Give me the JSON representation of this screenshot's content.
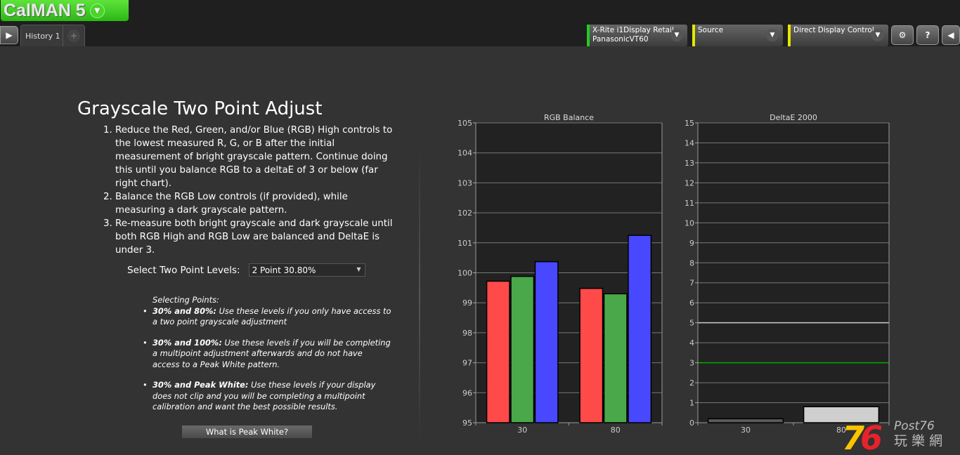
{
  "app": {
    "logo": "CalMAN 5"
  },
  "tabs": [
    {
      "label": "History 1"
    }
  ],
  "devices": [
    {
      "line1": "X-Rite i1Display Retail",
      "line2": "PanasonicVT60",
      "status_color": "#22cc22"
    },
    {
      "line1": "Source",
      "line2": "",
      "status_color": "#e6e600"
    },
    {
      "line1": "Direct Display Control",
      "line2": "",
      "status_color": "#e6e600"
    }
  ],
  "toolbar": {
    "settings": "gear-icon",
    "help": "?",
    "collapse": "chevron-left-icon"
  },
  "main": {
    "title": "Grayscale Two Point Adjust",
    "steps": [
      "Reduce the Red, Green, and/or Blue (RGB) High controls to the lowest measured R, G, or B after the initial measurement of bright grayscale pattern. Continue doing this until you balance RGB to a deltaE of 3 or below (far right chart).",
      "Balance the RGB Low controls (if provided), while measuring a dark grayscale pattern.",
      "Re-measure both bright grayscale and dark grayscale until both RGB High and RGB Low are balanced and DeltaE is under 3."
    ],
    "select_label": "Select Two Point Levels:",
    "select_value": "2 Point 30.80%",
    "points_heading": "Selecting Points:",
    "points": [
      {
        "bold": "30% and 80%:",
        "text": " Use these levels if you only have access to a two point grayscale adjustment"
      },
      {
        "bold": "30% and 100%:",
        "text": " Use these levels if you will be completing a multipoint adjustment afterwards and do not have access to a Peak White pattern."
      },
      {
        "bold": "30% and Peak White:",
        "text": " Use these levels if your display does not clip and you will be completing a multipoint calibration and want the best possible results."
      }
    ],
    "peak_button": "What is Peak White?"
  },
  "chart_data": [
    {
      "type": "bar",
      "title": "RGB Balance",
      "categories": [
        "30",
        "80"
      ],
      "ylim": [
        95,
        105
      ],
      "grid": true,
      "series": [
        {
          "color": "#ff4a4a",
          "values": [
            99.72,
            99.48
          ]
        },
        {
          "color": "#4aa84a",
          "values": [
            99.88,
            99.3
          ]
        },
        {
          "color": "#4848ff",
          "values": [
            100.37,
            101.25
          ]
        }
      ]
    },
    {
      "type": "bar",
      "title": "DeltaE 2000",
      "categories": [
        "30",
        "80"
      ],
      "ylim": [
        0,
        15
      ],
      "grid": true,
      "reference_lines": [
        {
          "value": 3,
          "color": "#00aa00"
        },
        {
          "value": 5,
          "color": "#cccccc"
        }
      ],
      "series": [
        {
          "colors": [
            "#5a5a5a",
            "#cfcfcf"
          ],
          "values": [
            0.2,
            0.8
          ]
        }
      ]
    }
  ],
  "watermark": {
    "text": "Post76 玩樂網",
    "number": "76"
  }
}
